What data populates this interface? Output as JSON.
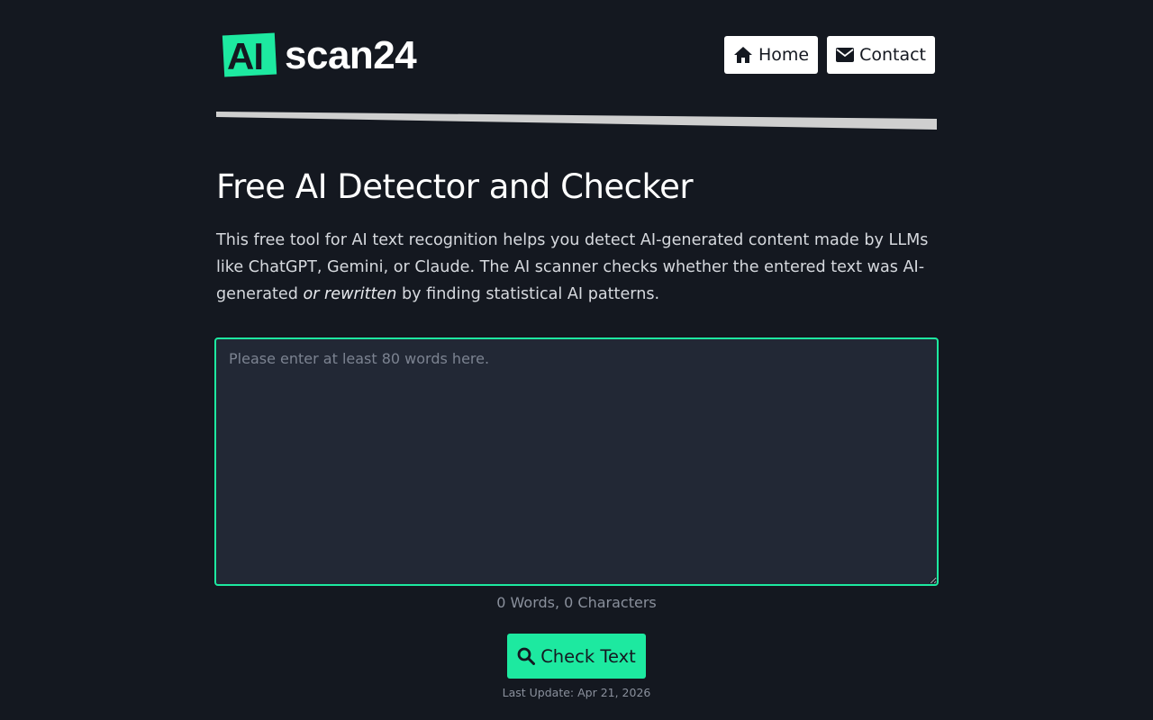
{
  "header": {
    "logo_badge": "AI",
    "logo_text": "scan24",
    "nav": {
      "home_label": "Home",
      "contact_label": "Contact",
      "home_icon": "home-icon",
      "contact_icon": "envelope-icon"
    }
  },
  "main": {
    "title": "Free AI Detector and Checker",
    "intro_before": "This free tool for AI text recognition helps you detect AI-generated content made by LLMs like ChatGPT, Gemini, or Claude. The AI scanner checks whether the entered text was AI-generated ",
    "intro_emphasis": "or rewritten",
    "intro_after": " by finding statistical AI patterns.",
    "textarea": {
      "value": "",
      "placeholder": "Please enter at least 80 words here."
    },
    "counter": "0 Words, 0 Characters",
    "check_button": {
      "label": "Check Text",
      "icon": "search-icon"
    },
    "last_update": "Last Update: Apr 21, 2026"
  },
  "colors": {
    "background": "#141820",
    "accent": "#1de9a0",
    "textarea_bg": "#222835",
    "nav_button_bg": "#ffffff"
  }
}
